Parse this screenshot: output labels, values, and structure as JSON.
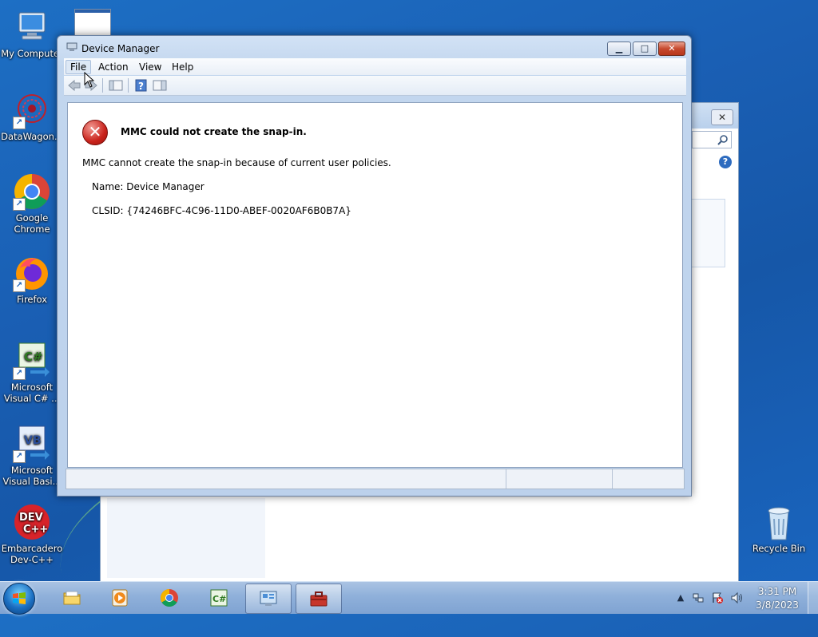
{
  "desktop": {
    "icons": [
      {
        "label": "My Computer",
        "icon": "computer-icon"
      },
      {
        "label": "DataWagon...",
        "icon": "datawagon-icon"
      },
      {
        "label": "Google Chrome",
        "icon": "chrome-icon"
      },
      {
        "label": "Firefox",
        "icon": "firefox-icon"
      },
      {
        "label": "Microsoft Visual C# ...",
        "icon": "visual-csharp-icon"
      },
      {
        "label": "Microsoft Visual Basi...",
        "icon": "visual-basic-icon"
      },
      {
        "label": "Embarcadero Dev-C++",
        "icon": "devcpp-icon"
      },
      {
        "label": "Recycle Bin",
        "icon": "recycle-bin-icon"
      }
    ]
  },
  "window": {
    "title": "Device Manager",
    "buttons": {
      "minimize": "▁",
      "maximize": "□",
      "close": "✕"
    },
    "menu": [
      "File",
      "Action",
      "View",
      "Help"
    ],
    "active_menu": "File",
    "toolbar_icons": [
      "back-icon",
      "forward-icon",
      "console-tree-icon",
      "help-icon",
      "action-pane-icon"
    ]
  },
  "error": {
    "icon": "error-icon",
    "title": "MMC could not create the snap-in.",
    "message": "MMC cannot create the snap-in because of current user policies.",
    "name_line": "Name: Device Manager",
    "clsid_line": "CLSID: {74246BFC-4C96-11D0-ABEF-0020AF6B0B7A}"
  },
  "taskbar": {
    "apps": [
      "file-explorer-icon",
      "media-player-icon",
      "chrome-icon",
      "visual-csharp-icon",
      "control-panel-icon",
      "toolbox-icon"
    ],
    "clock": {
      "time": "3:31 PM",
      "date": "3/8/2023"
    },
    "tray": [
      "show-hidden-icons-arrow",
      "network-icon",
      "action-center-icon",
      "volume-icon"
    ]
  },
  "colors": {
    "error_red": "#c9231c",
    "desktop_blue": "#1a5fb4",
    "close_red": "#c74a2f"
  }
}
